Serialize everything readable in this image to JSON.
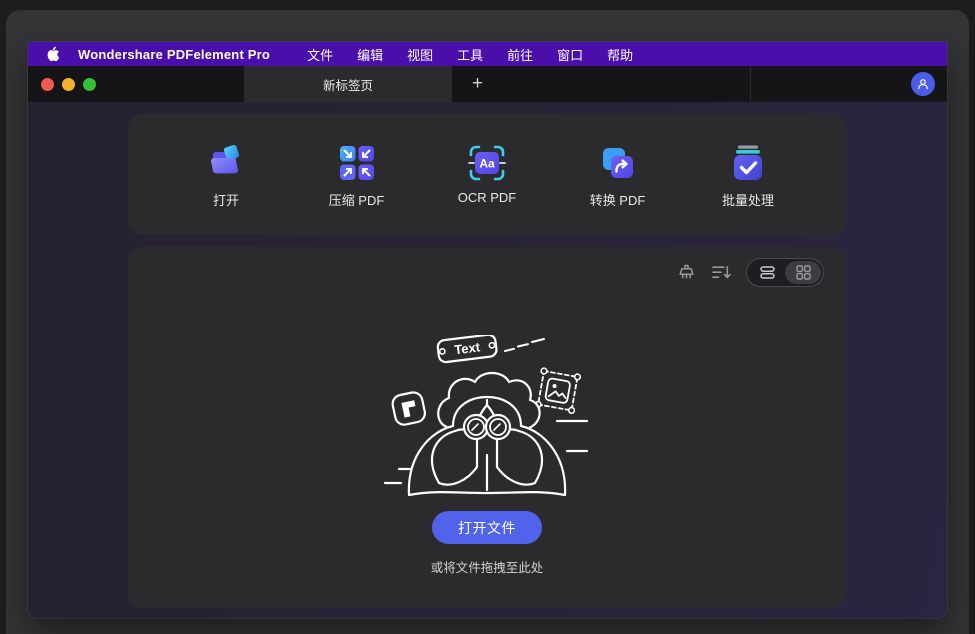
{
  "colors": {
    "menu_bar_bg": "#4a0fab",
    "accent_blue": "#5263eb",
    "avatar_blue": "#4a5ce8",
    "panel_bg": "#2b2b2d",
    "traffic_red": "#f05b51",
    "traffic_yellow": "#f3b32a",
    "traffic_green": "#33c13a"
  },
  "menu_bar": {
    "app_name": "Wondershare PDFelement Pro",
    "items": [
      {
        "label": "文件"
      },
      {
        "label": "编辑"
      },
      {
        "label": "视图"
      },
      {
        "label": "工具"
      },
      {
        "label": "前往"
      },
      {
        "label": "窗口"
      },
      {
        "label": "帮助"
      }
    ]
  },
  "tab_bar": {
    "active_tab_label": "新标签页",
    "new_tab_button": "+"
  },
  "quick_actions": {
    "items": [
      {
        "label": "打开",
        "icon": "open-folder-icon"
      },
      {
        "label": "压缩 PDF",
        "icon": "compress-pdf-icon"
      },
      {
        "label": "OCR PDF",
        "icon": "ocr-pdf-icon",
        "icon_text": "Aa"
      },
      {
        "label": "转换 PDF",
        "icon": "convert-pdf-icon"
      },
      {
        "label": "批量处理",
        "icon": "batch-process-icon"
      }
    ]
  },
  "recent_panel": {
    "toolbar": {
      "clear_icon": "clean-icon",
      "sort_icon": "sort-descending-icon",
      "view_toggle": {
        "selected": "grid"
      }
    },
    "empty_state": {
      "illustration_tag_text": "Text",
      "open_button_label": "打开文件",
      "drop_hint": "或将文件拖拽至此处"
    }
  }
}
